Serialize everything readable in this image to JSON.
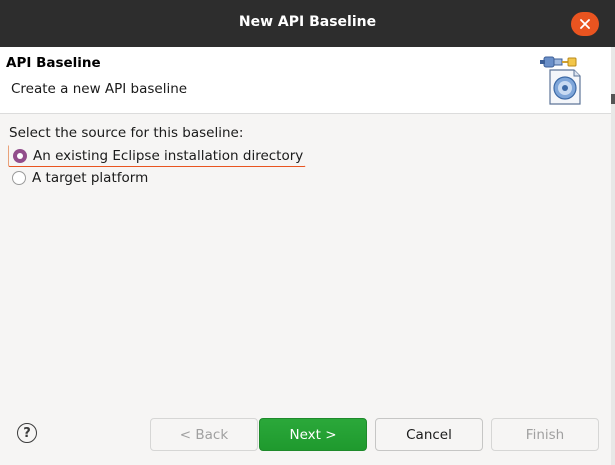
{
  "window": {
    "title": "New API Baseline"
  },
  "header": {
    "title": "API Baseline",
    "description": "Create a new API baseline"
  },
  "content": {
    "section_label": "Select the source for this baseline:",
    "options": [
      {
        "label": "An existing Eclipse installation directory",
        "checked": true
      },
      {
        "label": "A target platform",
        "checked": false
      }
    ]
  },
  "footer": {
    "help_glyph": "?",
    "back_label": "< Back",
    "next_label": "Next >",
    "cancel_label": "Cancel",
    "finish_label": "Finish"
  },
  "colors": {
    "titlebar": "#2d2d2d",
    "close": "#e95420",
    "radio_checked": "#924d8b",
    "primary_button": "#26a034"
  },
  "icons": {
    "close": "close-icon",
    "header": "api-baseline-wizard-icon",
    "help": "help-icon"
  }
}
